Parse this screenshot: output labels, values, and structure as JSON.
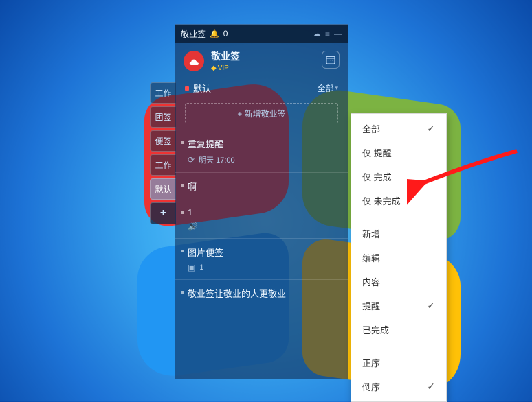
{
  "titlebar": {
    "app_title": "敬业签",
    "bell_count": "0"
  },
  "header": {
    "app_name": "敬业签",
    "vip_label": "VIP"
  },
  "subbar": {
    "current_category": "默认",
    "filter_label": "全部"
  },
  "new_note_label": "+ 新增敬业签",
  "side_tabs": [
    {
      "label": "工作"
    },
    {
      "label": "团签"
    },
    {
      "label": "便签"
    },
    {
      "label": "工作"
    },
    {
      "label": "默认"
    },
    {
      "label": "+"
    }
  ],
  "items": [
    {
      "title": "重复提醒",
      "meta_icon": "repeat",
      "meta_text": "明天 17:00"
    },
    {
      "title": "啊",
      "meta_icon": "",
      "meta_text": ""
    },
    {
      "title": "1",
      "meta_icon": "sound",
      "meta_text": ""
    },
    {
      "title": "图片便签",
      "meta_icon": "image",
      "meta_text": "1"
    },
    {
      "title": "敬业签让敬业的人更敬业",
      "meta_icon": "",
      "meta_text": ""
    }
  ],
  "menu": {
    "filters": [
      {
        "label": "全部",
        "checked": true
      },
      {
        "label": "仅 提醒",
        "checked": false
      },
      {
        "label": "仅 完成",
        "checked": false
      },
      {
        "label": "仅 未完成",
        "checked": false
      }
    ],
    "actions": [
      {
        "label": "新增",
        "checked": false
      },
      {
        "label": "编辑",
        "checked": false
      },
      {
        "label": "内容",
        "checked": false
      },
      {
        "label": "提醒",
        "checked": true
      },
      {
        "label": "已完成",
        "checked": false
      }
    ],
    "sort": [
      {
        "label": "正序",
        "checked": false
      },
      {
        "label": "倒序",
        "checked": true
      }
    ]
  },
  "colors": {
    "accent_red": "#e53535",
    "vip_gold": "#ffcc33",
    "arrow_red": "#ff1a1a"
  }
}
